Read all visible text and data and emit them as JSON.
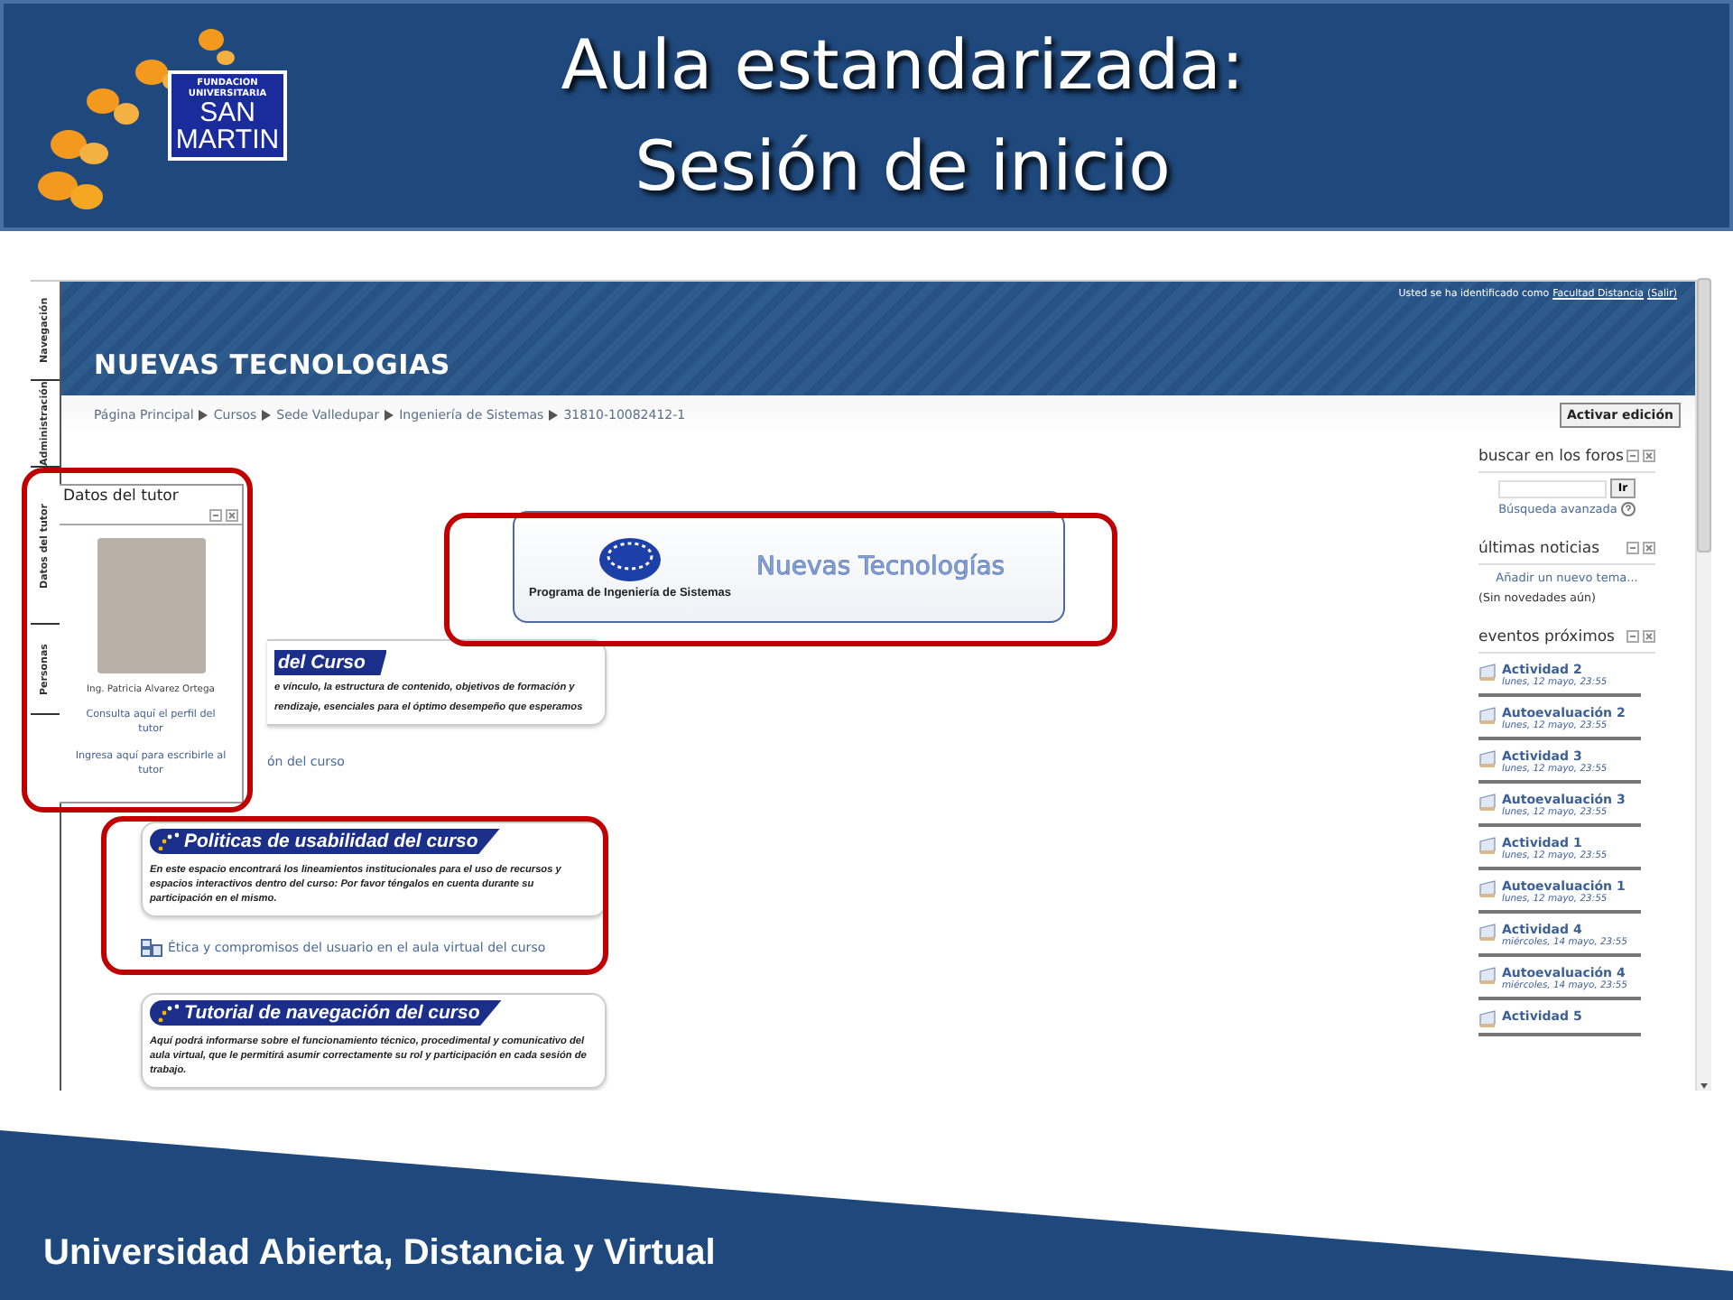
{
  "slide": {
    "logo": {
      "lines": [
        "FUNDACION",
        "UNIVERSITARIA",
        "SAN",
        "MARTIN"
      ]
    },
    "title_lines": [
      "Aula estandarizada:",
      "Sesión de inicio"
    ]
  },
  "screenshot": {
    "side_tabs": [
      "Navegación",
      "Administración",
      "Datos del tutor",
      "Personas"
    ],
    "course_title": "NUEVAS TECNOLOGIAS",
    "login": {
      "prefix": "Usted se ha identificado como",
      "user": "Facultad Distancia",
      "logout": "(Salir)"
    },
    "breadcrumb": [
      "Página Principal",
      "Cursos",
      "Sede Valledupar",
      "Ingeniería de Sistemas",
      "31810-10082412-1"
    ],
    "edit_button": "Activar edición",
    "tutor_block": {
      "title": "Datos del tutor",
      "name": "Ing. Patricia Alvarez Ortega",
      "links": [
        "Consulta aquí el perfil del tutor",
        "Ingresa aquí para escribirle al tutor"
      ]
    },
    "banner": {
      "program": "Programa de Ingeniería de Sistemas",
      "course": "Nuevas Tecnologías"
    },
    "sections": [
      {
        "kind": "cut",
        "title": "del Curso",
        "text": [
          "e vínculo, la estructura de contenido, objetivos de formación y",
          "rendizaje, esenciales para el óptimo desempeño  que esperamos"
        ],
        "link": "ón del curso"
      },
      {
        "kind": "full",
        "title": "Politicas de usabilidad del curso",
        "text": [
          "En este espacio encontrará los lineamientos institucionales para el uso de recursos y espacios interactivos dentro del curso: Por favor téngalos en cuenta durante su participación en el mismo."
        ],
        "link": "Ética y compromisos del usuario en el aula virtual del curso"
      },
      {
        "kind": "full",
        "title": "Tutorial de navegación del curso",
        "text": [
          "Aquí podrá informarse sobre el funcionamiento técnico, procedimental y comunicativo del aula virtual, que le permitirá asumir correctamente su rol y participación en cada sesión de trabajo."
        ]
      }
    ],
    "search_block": {
      "title": "buscar en los foros",
      "button": "Ir",
      "advanced": "Búsqueda avanzada"
    },
    "news_block": {
      "title": "últimas noticias",
      "add": "Añadir un nuevo tema...",
      "empty": "(Sin novedades aún)"
    },
    "events_block": {
      "title": "eventos próximos",
      "events": [
        {
          "name": "Actividad 2",
          "date": "lunes, 12 mayo, 23:55"
        },
        {
          "name": "Autoevaluación 2",
          "date": "lunes, 12 mayo, 23:55"
        },
        {
          "name": "Actividad 3",
          "date": "lunes, 12 mayo, 23:55"
        },
        {
          "name": "Autoevaluación 3",
          "date": "lunes, 12 mayo, 23:55"
        },
        {
          "name": "Actividad 1",
          "date": "lunes, 12 mayo, 23:55"
        },
        {
          "name": "Autoevaluación 1",
          "date": "lunes, 12 mayo, 23:55"
        },
        {
          "name": "Actividad 4",
          "date": "miércoles, 14 mayo, 23:55"
        },
        {
          "name": "Autoevaluación 4",
          "date": "miércoles, 14 mayo, 23:55"
        },
        {
          "name": "Actividad 5"
        }
      ]
    }
  },
  "footer": "Universidad Abierta, Distancia y Virtual"
}
